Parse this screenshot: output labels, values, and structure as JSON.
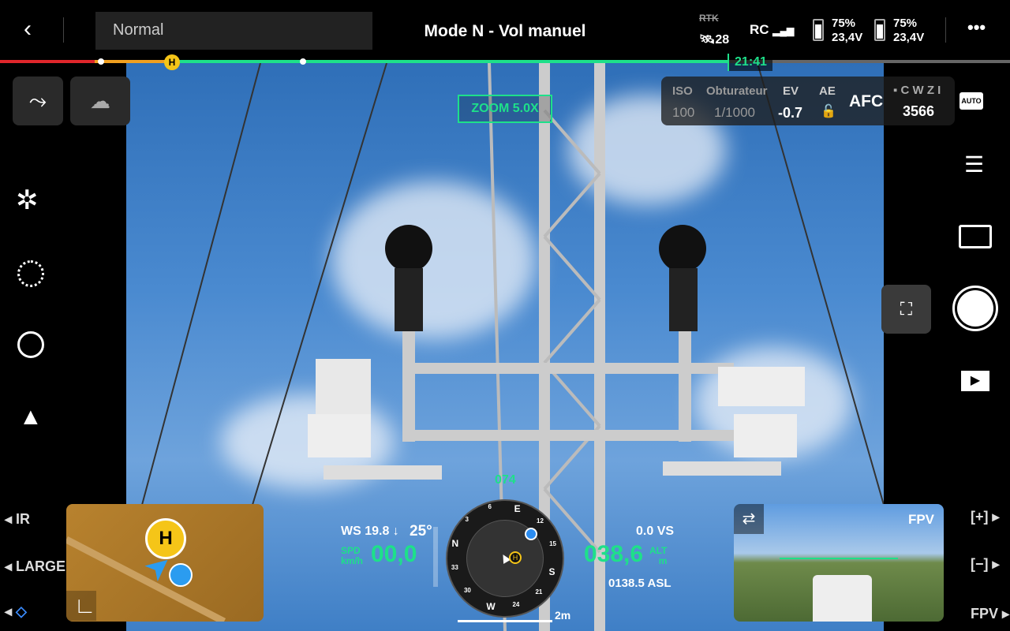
{
  "header": {
    "mode_select": "Normal",
    "title": "Mode N - Vol manuel",
    "rtk_label": "RTK",
    "satellites": "28",
    "rc_label": "RC",
    "battery1": {
      "percent": "75%",
      "voltage": "23,4V"
    },
    "battery2": {
      "percent": "75%",
      "voltage": "23,4V"
    },
    "more_icon": "more-horizontal-icon"
  },
  "timeline": {
    "time_remaining": "21:41",
    "home_marker": "H",
    "colors": {
      "red": "#e0262b",
      "orange": "#f0a020",
      "green": "#1ee08a"
    }
  },
  "camera": {
    "zoom": "ZOOM  5.0X",
    "iso_label": "ISO",
    "iso": "100",
    "shutter_label": "Obturateur",
    "shutter": "1/1000",
    "ev_label": "EV",
    "ev": "-0.7",
    "ae_label": "AE",
    "focus": "AFC",
    "lenses": "C W Z I",
    "photo_count": "3566",
    "mode_badge": "AUTO"
  },
  "left": {
    "ir": "IR",
    "large": "LARGE"
  },
  "telemetry": {
    "wind": "WS 19.8 ↓",
    "gimbal": "25°",
    "spd_label": "SPD",
    "spd_unit": "km/h",
    "speed": "00,0",
    "heading": "074",
    "vs": "0.0 VS",
    "alt_label": "ALT",
    "alt_unit": "m",
    "altitude": "038,6",
    "asl": "0138.5 ASL",
    "scale": "2m"
  },
  "compass": {
    "labels": [
      "N",
      "3",
      "6",
      "E",
      "12",
      "15",
      "S",
      "21",
      "24",
      "W",
      "30",
      "33"
    ]
  },
  "map": {
    "home": "H"
  },
  "fpv": {
    "label": "FPV"
  },
  "right": {
    "zoom_in": "[+]",
    "zoom_out": "[−]",
    "fpv": "FPV"
  }
}
